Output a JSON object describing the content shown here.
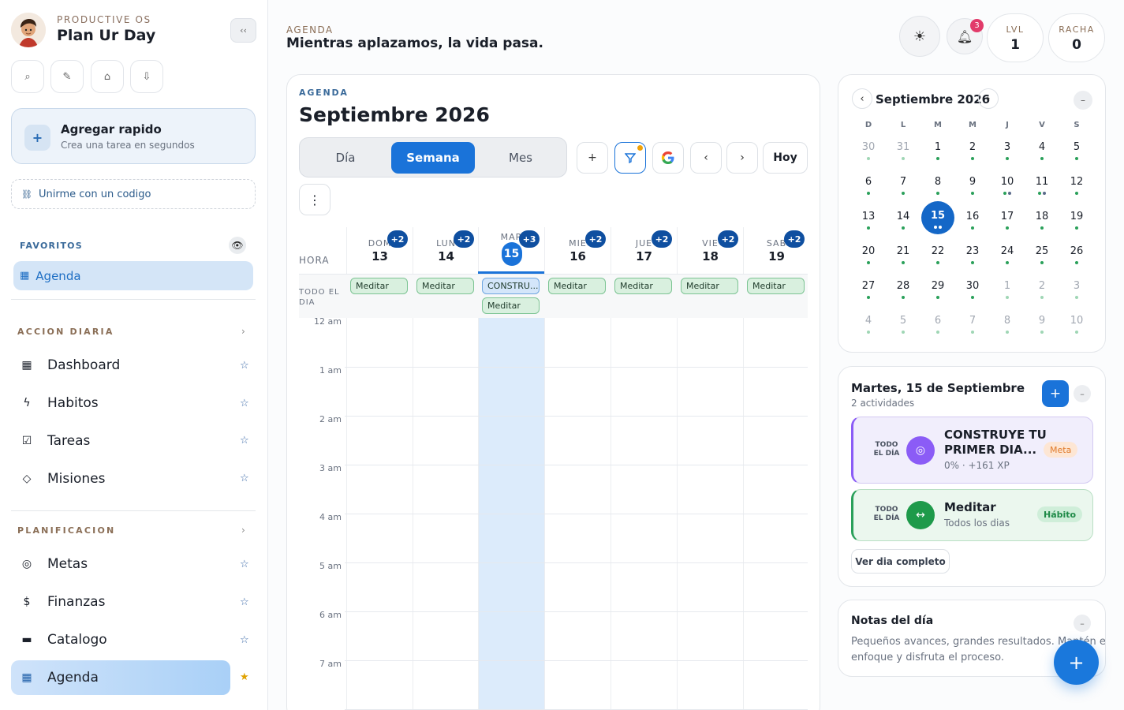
{
  "brand": {
    "kicker": "PRODUCTIVE OS",
    "name": "Plan Ur Day",
    "collapse_icon": "‹‹"
  },
  "tools": [
    {
      "name": "search-icon",
      "glyph": "⌕"
    },
    {
      "name": "pen-icon",
      "glyph": "✎"
    },
    {
      "name": "inbox-icon",
      "glyph": "⌂"
    },
    {
      "name": "download-icon",
      "glyph": "⇩"
    }
  ],
  "quick_add": {
    "title": "Agregar rapido",
    "subtitle": "Crea una tarea en segundos"
  },
  "join": {
    "label": "Unirme con un codigo"
  },
  "favorites": {
    "label": "FAVORITOS",
    "item": "Agenda"
  },
  "sections": {
    "daily": "ACCION DIARIA",
    "planning": "PLANIFICACION"
  },
  "nav": {
    "dashboard": "Dashboard",
    "habits": "Habitos",
    "tasks": "Tareas",
    "missions": "Misiones",
    "goals": "Metas",
    "finance": "Finanzas",
    "catalog": "Catalogo",
    "agenda": "Agenda"
  },
  "header": {
    "kicker": "AGENDA",
    "motto": "Mientras aplazamos, la vida pasa.",
    "notif_count": "3",
    "level_label": "LVL",
    "level_value": "1",
    "streak_label": "RACHA",
    "streak_value": "0"
  },
  "agenda": {
    "kicker": "AGENDA",
    "title": "Septiembre 2026",
    "views": {
      "day": "Día",
      "week": "Semana",
      "month": "Mes"
    },
    "today_label": "Hoy",
    "hour_label": "HORA",
    "allday_label_1": "TODO EL",
    "allday_label_2": "DIA",
    "days": [
      {
        "name": "DOM",
        "num": "13",
        "badge": "+2",
        "chips": [
          "Meditar"
        ]
      },
      {
        "name": "LUN",
        "num": "14",
        "badge": "+2",
        "chips": [
          "Meditar"
        ]
      },
      {
        "name": "MAR",
        "num": "15",
        "badge": "+3",
        "chips": [
          "CONSTRU...",
          "Meditar"
        ]
      },
      {
        "name": "MIE",
        "num": "16",
        "badge": "+2",
        "chips": [
          "Meditar"
        ]
      },
      {
        "name": "JUE",
        "num": "17",
        "badge": "+2",
        "chips": [
          "Meditar"
        ]
      },
      {
        "name": "VIE",
        "num": "18",
        "badge": "+2",
        "chips": [
          "Meditar"
        ]
      },
      {
        "name": "SAB",
        "num": "19",
        "badge": "+2",
        "chips": [
          "Meditar"
        ]
      }
    ],
    "hours": [
      "12 am",
      "1 am",
      "2 am",
      "3 am",
      "4 am",
      "5 am",
      "6 am",
      "7 am"
    ]
  },
  "mini_calendar": {
    "title": "Septiembre 2026",
    "dow": [
      "D",
      "L",
      "M",
      "M",
      "J",
      "V",
      "S"
    ],
    "weeks": [
      [
        "30",
        "31",
        "1",
        "2",
        "3",
        "4",
        "5"
      ],
      [
        "6",
        "7",
        "8",
        "9",
        "10",
        "11",
        "12"
      ],
      [
        "13",
        "14",
        "15",
        "16",
        "17",
        "18",
        "19"
      ],
      [
        "20",
        "21",
        "22",
        "23",
        "24",
        "25",
        "26"
      ],
      [
        "27",
        "28",
        "29",
        "30",
        "1",
        "2",
        "3"
      ],
      [
        "4",
        "5",
        "6",
        "7",
        "8",
        "9",
        "10"
      ]
    ],
    "selected": "15"
  },
  "day_panel": {
    "title": "Martes, 15 de Septiembre",
    "subtitle": "2 actividades",
    "when_1": "TODO",
    "when_2": "EL DÍA",
    "goal": {
      "name_1": "CONSTRUYE TU",
      "name_2": "PRIMER DIA...",
      "meta": "0% · +161 XP",
      "tag": "Meta"
    },
    "habit": {
      "name": "Meditar",
      "meta": "Todos los dias",
      "tag": "Hábito"
    },
    "see_all": "Ver dia completo"
  },
  "notes": {
    "title": "Notas del día",
    "text": "Pequeños avances, grandes resultados. Mantén el enfoque y disfruta el proceso."
  },
  "colors": {
    "accent": "#1a73d9",
    "goal": "#8b5cf6",
    "habit": "#2aa05a",
    "badge": "#0f4fa0"
  }
}
